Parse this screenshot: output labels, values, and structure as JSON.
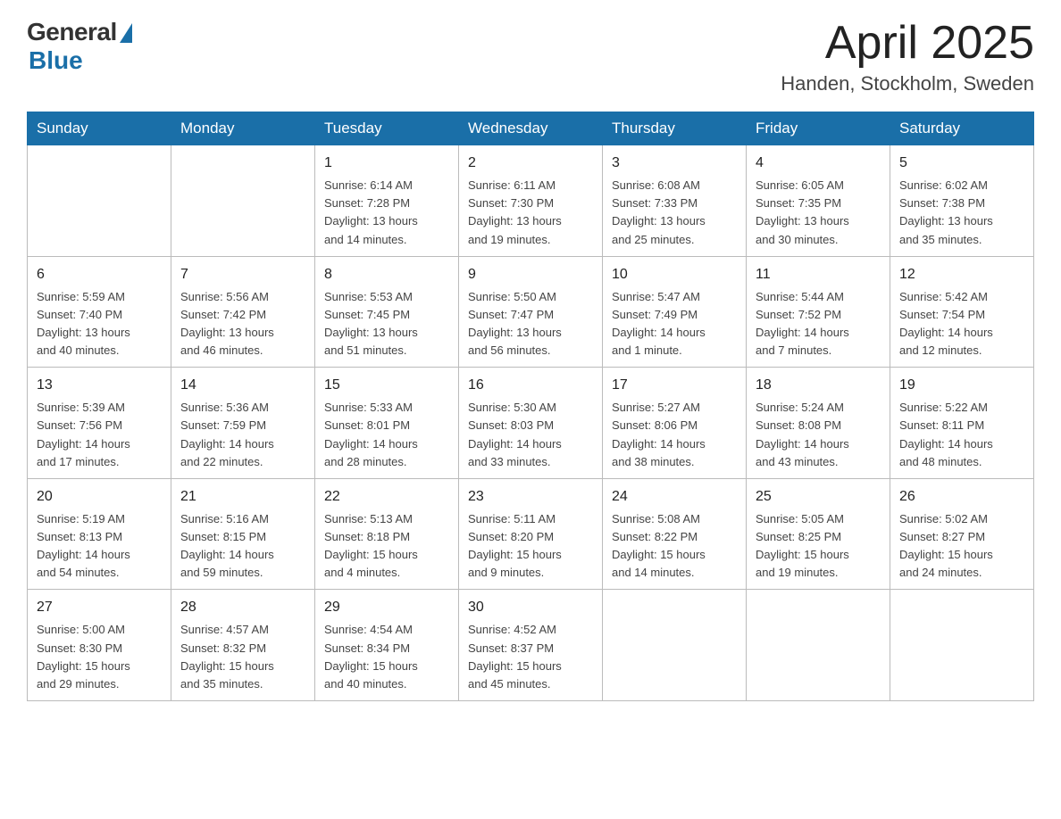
{
  "header": {
    "logo_general": "General",
    "logo_blue": "Blue",
    "month_title": "April 2025",
    "location": "Handen, Stockholm, Sweden"
  },
  "weekdays": [
    "Sunday",
    "Monday",
    "Tuesday",
    "Wednesday",
    "Thursday",
    "Friday",
    "Saturday"
  ],
  "weeks": [
    [
      {
        "day": "",
        "info": ""
      },
      {
        "day": "",
        "info": ""
      },
      {
        "day": "1",
        "info": "Sunrise: 6:14 AM\nSunset: 7:28 PM\nDaylight: 13 hours\nand 14 minutes."
      },
      {
        "day": "2",
        "info": "Sunrise: 6:11 AM\nSunset: 7:30 PM\nDaylight: 13 hours\nand 19 minutes."
      },
      {
        "day": "3",
        "info": "Sunrise: 6:08 AM\nSunset: 7:33 PM\nDaylight: 13 hours\nand 25 minutes."
      },
      {
        "day": "4",
        "info": "Sunrise: 6:05 AM\nSunset: 7:35 PM\nDaylight: 13 hours\nand 30 minutes."
      },
      {
        "day": "5",
        "info": "Sunrise: 6:02 AM\nSunset: 7:38 PM\nDaylight: 13 hours\nand 35 minutes."
      }
    ],
    [
      {
        "day": "6",
        "info": "Sunrise: 5:59 AM\nSunset: 7:40 PM\nDaylight: 13 hours\nand 40 minutes."
      },
      {
        "day": "7",
        "info": "Sunrise: 5:56 AM\nSunset: 7:42 PM\nDaylight: 13 hours\nand 46 minutes."
      },
      {
        "day": "8",
        "info": "Sunrise: 5:53 AM\nSunset: 7:45 PM\nDaylight: 13 hours\nand 51 minutes."
      },
      {
        "day": "9",
        "info": "Sunrise: 5:50 AM\nSunset: 7:47 PM\nDaylight: 13 hours\nand 56 minutes."
      },
      {
        "day": "10",
        "info": "Sunrise: 5:47 AM\nSunset: 7:49 PM\nDaylight: 14 hours\nand 1 minute."
      },
      {
        "day": "11",
        "info": "Sunrise: 5:44 AM\nSunset: 7:52 PM\nDaylight: 14 hours\nand 7 minutes."
      },
      {
        "day": "12",
        "info": "Sunrise: 5:42 AM\nSunset: 7:54 PM\nDaylight: 14 hours\nand 12 minutes."
      }
    ],
    [
      {
        "day": "13",
        "info": "Sunrise: 5:39 AM\nSunset: 7:56 PM\nDaylight: 14 hours\nand 17 minutes."
      },
      {
        "day": "14",
        "info": "Sunrise: 5:36 AM\nSunset: 7:59 PM\nDaylight: 14 hours\nand 22 minutes."
      },
      {
        "day": "15",
        "info": "Sunrise: 5:33 AM\nSunset: 8:01 PM\nDaylight: 14 hours\nand 28 minutes."
      },
      {
        "day": "16",
        "info": "Sunrise: 5:30 AM\nSunset: 8:03 PM\nDaylight: 14 hours\nand 33 minutes."
      },
      {
        "day": "17",
        "info": "Sunrise: 5:27 AM\nSunset: 8:06 PM\nDaylight: 14 hours\nand 38 minutes."
      },
      {
        "day": "18",
        "info": "Sunrise: 5:24 AM\nSunset: 8:08 PM\nDaylight: 14 hours\nand 43 minutes."
      },
      {
        "day": "19",
        "info": "Sunrise: 5:22 AM\nSunset: 8:11 PM\nDaylight: 14 hours\nand 48 minutes."
      }
    ],
    [
      {
        "day": "20",
        "info": "Sunrise: 5:19 AM\nSunset: 8:13 PM\nDaylight: 14 hours\nand 54 minutes."
      },
      {
        "day": "21",
        "info": "Sunrise: 5:16 AM\nSunset: 8:15 PM\nDaylight: 14 hours\nand 59 minutes."
      },
      {
        "day": "22",
        "info": "Sunrise: 5:13 AM\nSunset: 8:18 PM\nDaylight: 15 hours\nand 4 minutes."
      },
      {
        "day": "23",
        "info": "Sunrise: 5:11 AM\nSunset: 8:20 PM\nDaylight: 15 hours\nand 9 minutes."
      },
      {
        "day": "24",
        "info": "Sunrise: 5:08 AM\nSunset: 8:22 PM\nDaylight: 15 hours\nand 14 minutes."
      },
      {
        "day": "25",
        "info": "Sunrise: 5:05 AM\nSunset: 8:25 PM\nDaylight: 15 hours\nand 19 minutes."
      },
      {
        "day": "26",
        "info": "Sunrise: 5:02 AM\nSunset: 8:27 PM\nDaylight: 15 hours\nand 24 minutes."
      }
    ],
    [
      {
        "day": "27",
        "info": "Sunrise: 5:00 AM\nSunset: 8:30 PM\nDaylight: 15 hours\nand 29 minutes."
      },
      {
        "day": "28",
        "info": "Sunrise: 4:57 AM\nSunset: 8:32 PM\nDaylight: 15 hours\nand 35 minutes."
      },
      {
        "day": "29",
        "info": "Sunrise: 4:54 AM\nSunset: 8:34 PM\nDaylight: 15 hours\nand 40 minutes."
      },
      {
        "day": "30",
        "info": "Sunrise: 4:52 AM\nSunset: 8:37 PM\nDaylight: 15 hours\nand 45 minutes."
      },
      {
        "day": "",
        "info": ""
      },
      {
        "day": "",
        "info": ""
      },
      {
        "day": "",
        "info": ""
      }
    ]
  ]
}
